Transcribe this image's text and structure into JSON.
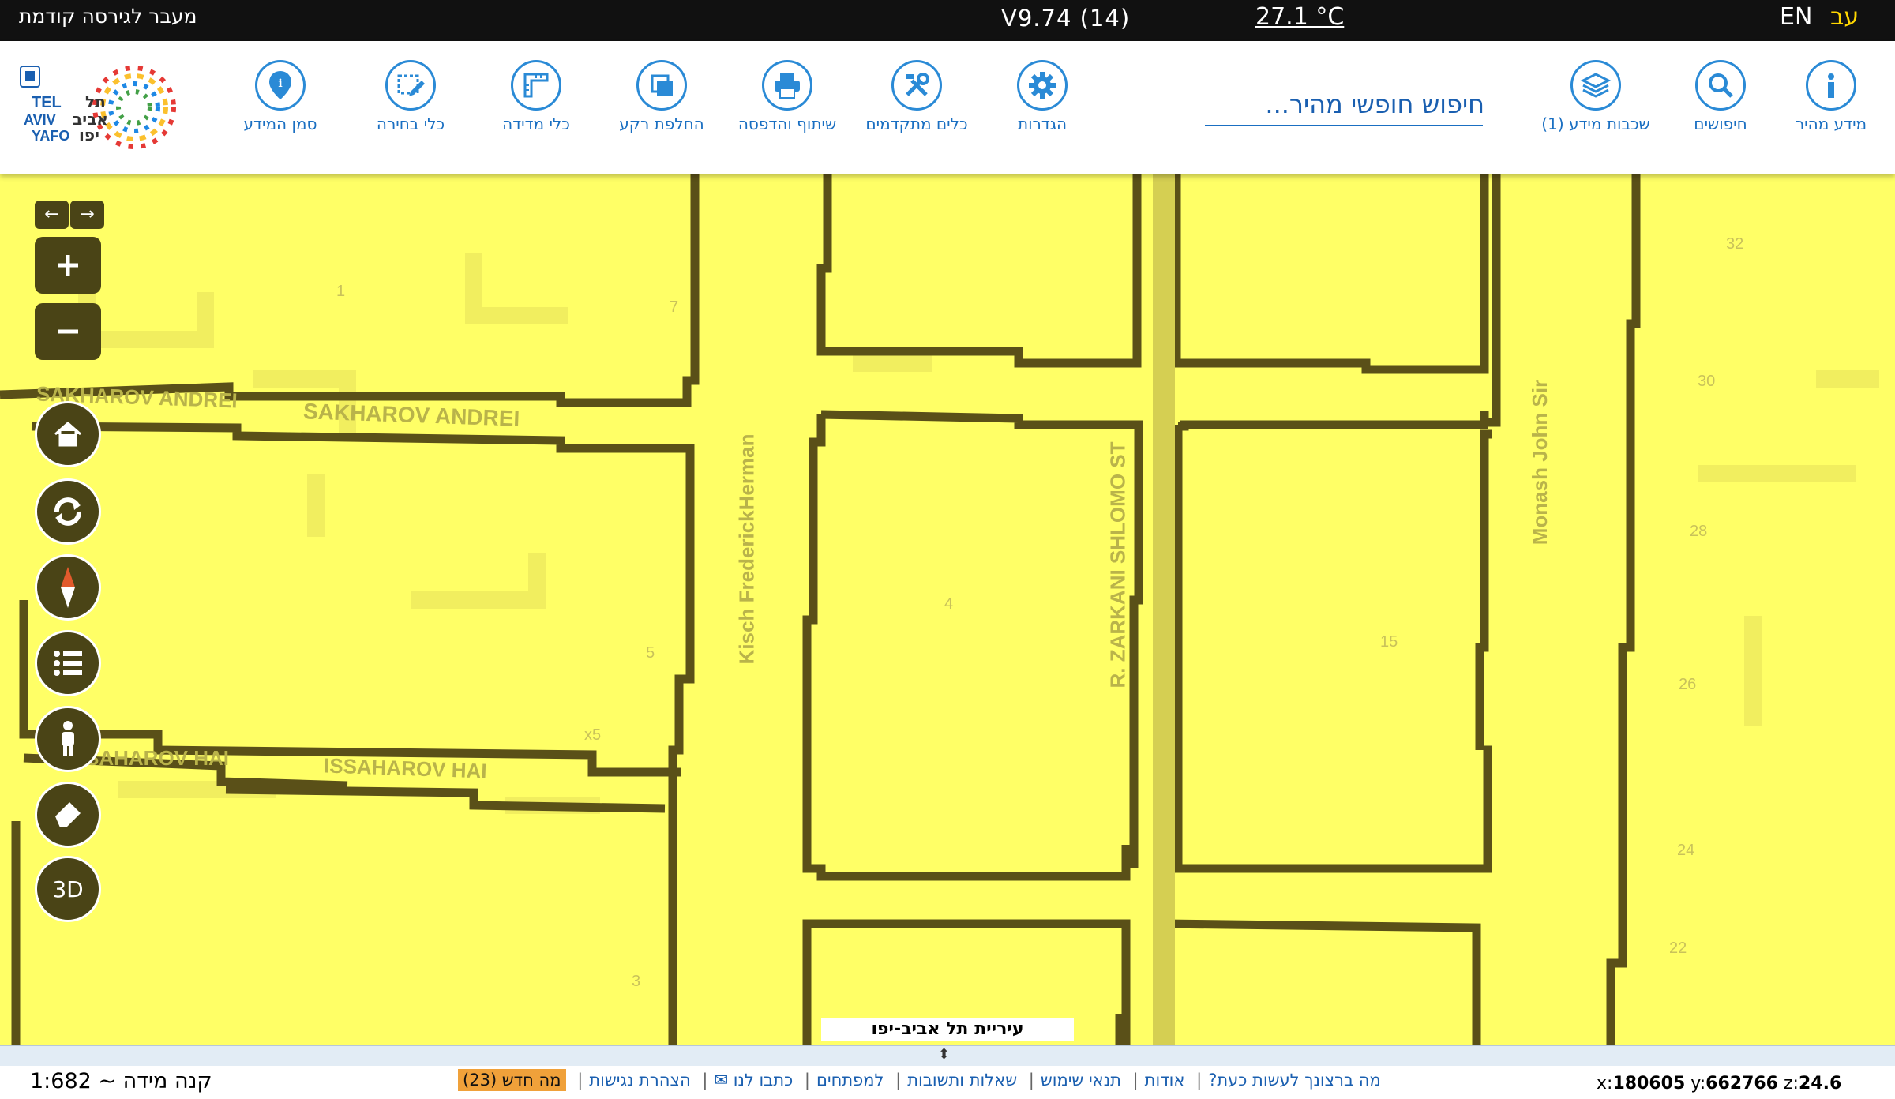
{
  "topbar": {
    "prev_version": "מעבר לגירסה קודמת",
    "version": "V9.74 (14)",
    "temperature": "27.1 °C",
    "lang_en": "EN",
    "lang_he": "עב"
  },
  "toolbar": {
    "items": [
      {
        "label": "מידע מהיר",
        "icon": "info-icon"
      },
      {
        "label": "חיפושים",
        "icon": "search-icon"
      },
      {
        "label": "שכבות מידע (1)",
        "icon": "layers-icon"
      },
      {
        "label": "הגדרות",
        "icon": "gear-icon"
      },
      {
        "label": "כלים מתקדמים",
        "icon": "tools-icon"
      },
      {
        "label": "שיתוף והדפסה",
        "icon": "print-icon"
      },
      {
        "label": "החלפת רקע",
        "icon": "background-swap-icon"
      },
      {
        "label": "כלי מדידה",
        "icon": "ruler-icon"
      },
      {
        "label": "כלי בחירה",
        "icon": "select-icon"
      },
      {
        "label": "סמן המידע",
        "icon": "info-marker-icon"
      }
    ],
    "search_placeholder": "חיפוש חופשי מהיר..."
  },
  "logo": {
    "text_en": "TEL AVIV YAFO",
    "text_he": "תל אביב יפו"
  },
  "map": {
    "controls": [
      "zoom-in",
      "zoom-out",
      "home",
      "refresh",
      "compass",
      "legend",
      "street-view",
      "eraser",
      "3D"
    ],
    "label_3d": "3D",
    "street_labels": [
      "SAKHAROV ANDREI",
      "SAKHAROV ANDREI",
      "ISSAHAROV HAI",
      "SAHAROV HAI",
      "Kisch FrederickHerman",
      "R. ZARKANI SHLOMO ST",
      "Monash John Sir"
    ],
    "numbers": [
      "1",
      "7",
      "5",
      "x5",
      "3",
      "4",
      "15",
      "32",
      "30",
      "28",
      "26",
      "24",
      "22"
    ],
    "city_label": "עיריית תל אביב-יפו"
  },
  "footer": {
    "scale": "קנה מידה ~ 1:682",
    "links": [
      "מה ברצונך לעשות כעת?",
      "אודות",
      "תנאי שימוש",
      "שאלות ותשובות",
      "למפתחים",
      "כתבו לנו ✉",
      "הצהרת נגישות"
    ],
    "new_badge": "מה חדש (23)",
    "coords": {
      "x_label": "x:",
      "x": "180605",
      "y_label": "y:",
      "y": "662766",
      "z_label": "z:",
      "z": "24.6"
    }
  }
}
